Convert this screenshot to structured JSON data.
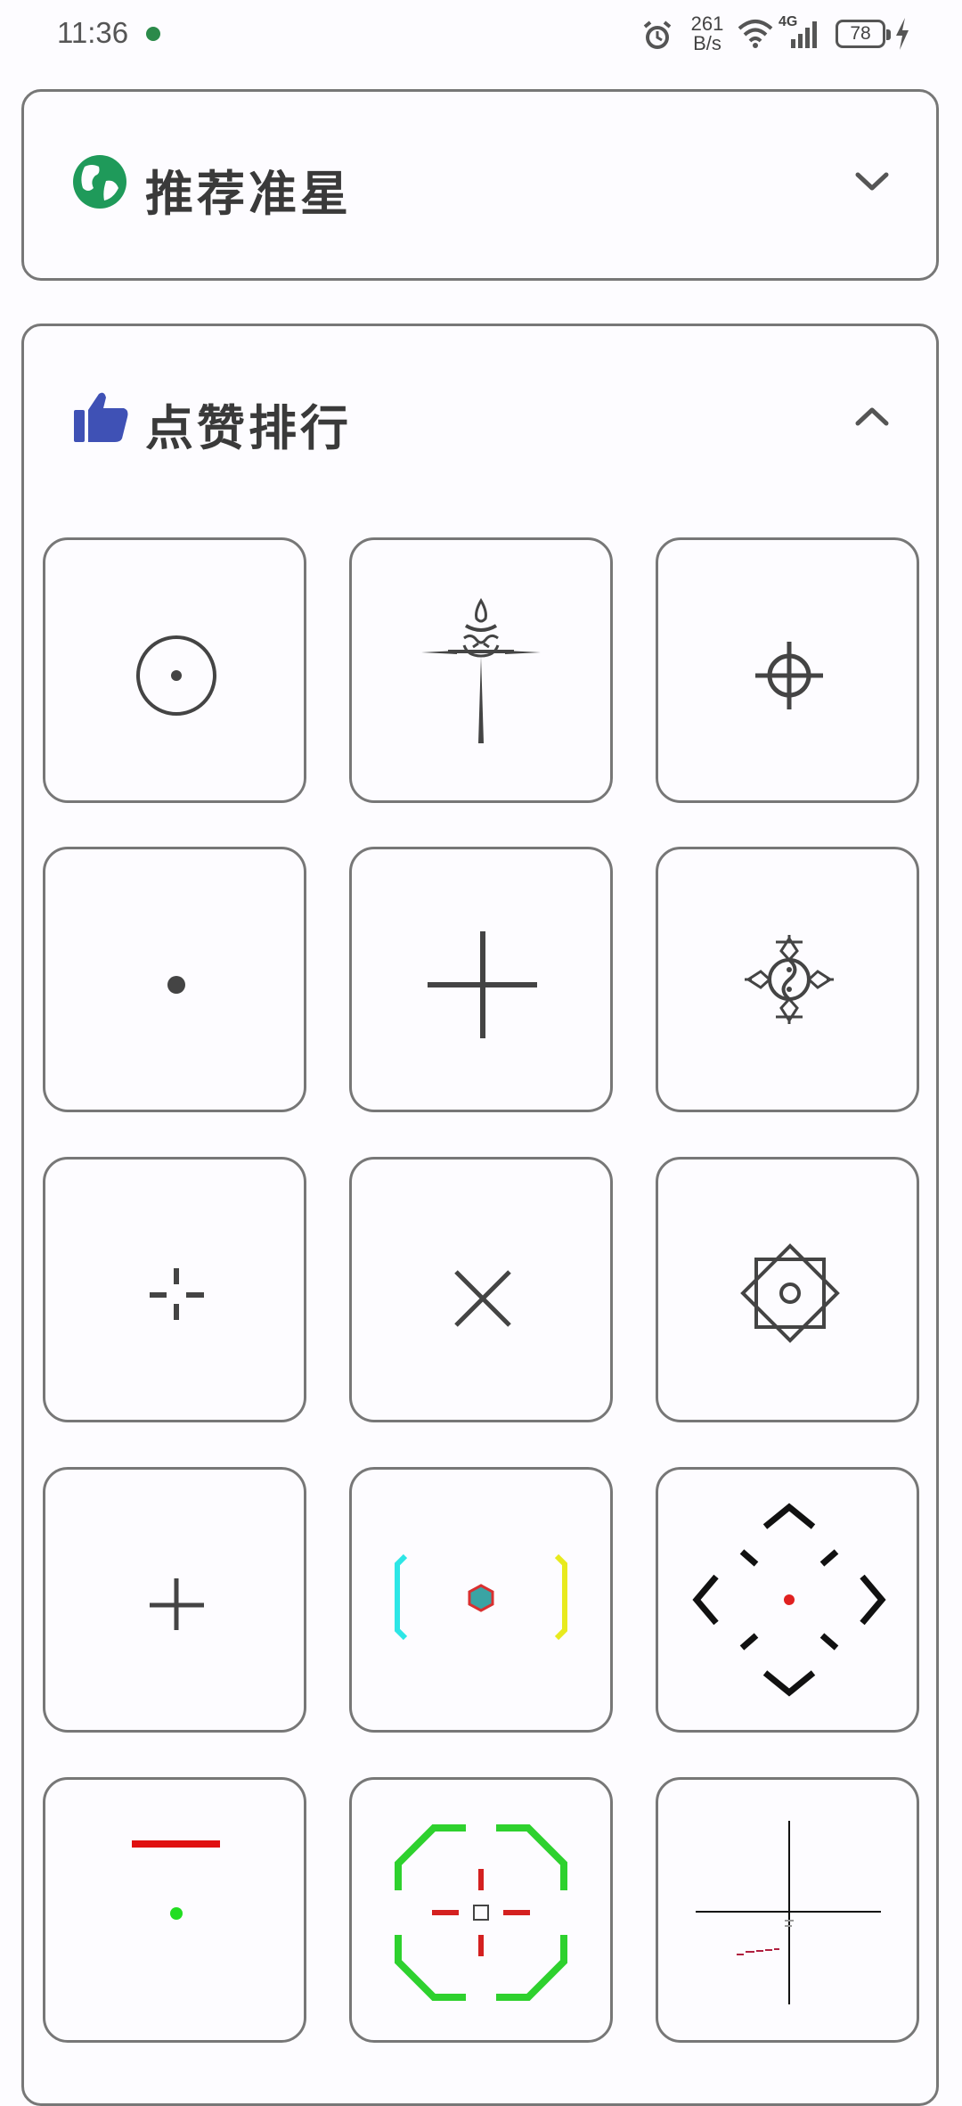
{
  "status_bar": {
    "time": "11:36",
    "net_speed_value": "261",
    "net_speed_unit": "B/s",
    "signal_label": "4G",
    "battery": "78",
    "icons": [
      "alarm-icon",
      "wifi-icon",
      "signal-icon",
      "battery-icon",
      "charging-icon"
    ]
  },
  "sections": [
    {
      "title": "推荐准星",
      "icon": "globe-icon",
      "expanded": false,
      "accent": "#1f9a5a"
    },
    {
      "title": "点赞排行",
      "icon": "thumbs-up-icon",
      "expanded": true,
      "accent": "#3f51b5"
    }
  ],
  "crosshairs": [
    {
      "name": "circle-dot-crosshair"
    },
    {
      "name": "ornate-torch-crosshair"
    },
    {
      "name": "scope-crosshair"
    },
    {
      "name": "dot-crosshair"
    },
    {
      "name": "large-plus-crosshair"
    },
    {
      "name": "yin-yang-ornament-crosshair"
    },
    {
      "name": "gapped-plus-crosshair"
    },
    {
      "name": "x-crosshair"
    },
    {
      "name": "diamond-square-crosshair"
    },
    {
      "name": "small-plus-crosshair"
    },
    {
      "name": "colored-brackets-hexagon-crosshair"
    },
    {
      "name": "chevron-diamond-crosshair"
    },
    {
      "name": "red-line-green-dot-crosshair"
    },
    {
      "name": "green-octagon-crosshair"
    },
    {
      "name": "thin-line-crosshair"
    }
  ]
}
